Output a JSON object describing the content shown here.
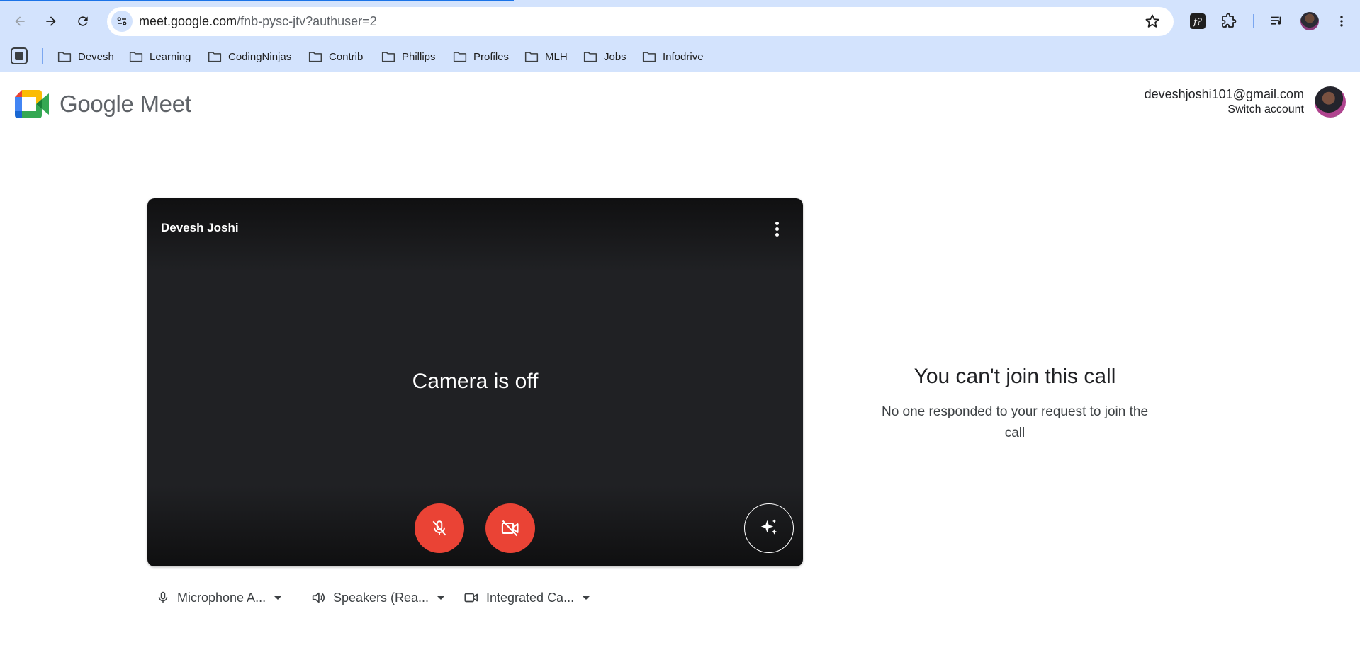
{
  "browser": {
    "url_domain": "meet.google.com",
    "url_path": "/fnb-pysc-jtv?authuser=2",
    "bookmarks": [
      "Devesh",
      "Learning",
      "CodingNinjas",
      "Contrib",
      "Phillips",
      "Profiles",
      "MLH",
      "Jobs",
      "Infodrive"
    ],
    "icons": [
      "back-icon",
      "forward-icon",
      "reload-icon",
      "site-info-icon",
      "star-icon",
      "formula-extension-icon",
      "extensions-puzzle-icon",
      "media-controls-icon",
      "profile-avatar",
      "kebab-menu-icon"
    ]
  },
  "meet": {
    "brand": "Google Meet",
    "account_email": "deveshjoshi101@gmail.com",
    "switch_account": "Switch account",
    "preview": {
      "participant_name": "Devesh Joshi",
      "camera_status": "Camera is off",
      "mic_state": "muted",
      "camera_state": "off"
    },
    "devices": {
      "microphone": "Microphone A...",
      "speakers": "Speakers (Rea...",
      "camera": "Integrated Ca..."
    },
    "status": {
      "title": "You can't join this call",
      "message": "No one responded to your request to join the call"
    }
  },
  "colors": {
    "chrome_toolbar": "#d3e3fd",
    "control_red": "#ea4335",
    "preview_bg": "#202124"
  }
}
